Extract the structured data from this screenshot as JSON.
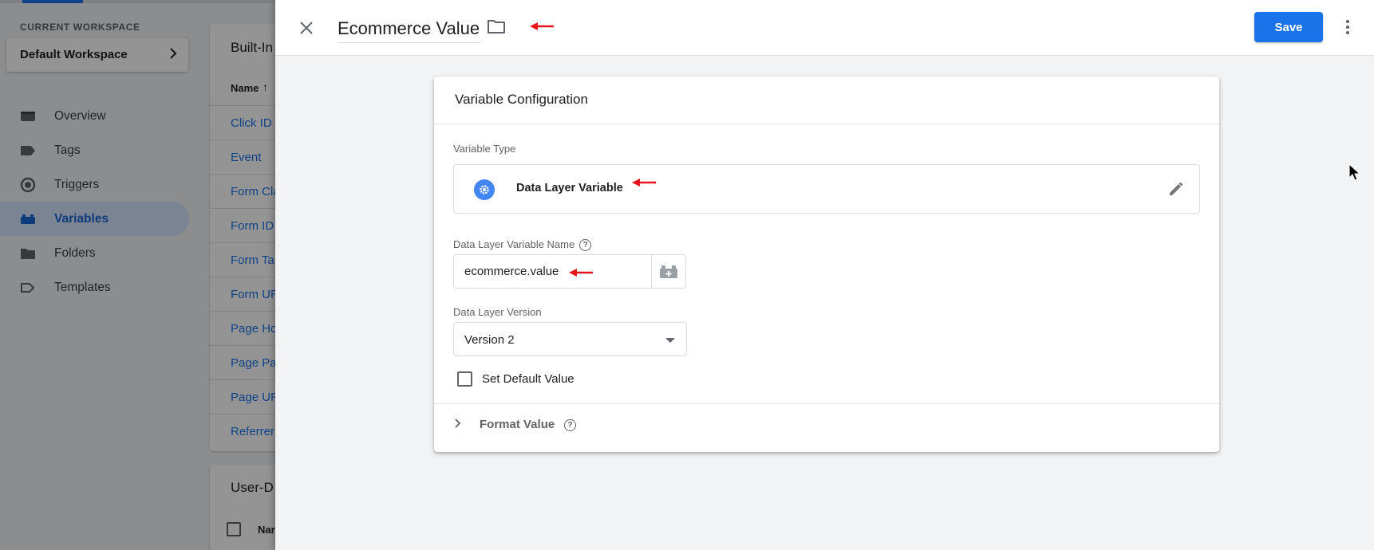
{
  "sidebar": {
    "workspace_label": "CURRENT WORKSPACE",
    "workspace_name": "Default Workspace",
    "items": [
      {
        "label": "Overview",
        "icon": "overview-icon"
      },
      {
        "label": "Tags",
        "icon": "tag-icon"
      },
      {
        "label": "Triggers",
        "icon": "trigger-icon"
      },
      {
        "label": "Variables",
        "icon": "variables-icon",
        "active": true
      },
      {
        "label": "Folders",
        "icon": "folder-icon"
      },
      {
        "label": "Templates",
        "icon": "template-icon"
      }
    ]
  },
  "builtin": {
    "title": "Built-In",
    "name_header": "Name",
    "rows": [
      "Click ID",
      "Event",
      "Form Cla",
      "Form ID",
      "Form Ta",
      "Form UR",
      "Page Ho",
      "Page Pa",
      "Page UR",
      "Referrer"
    ]
  },
  "user_defined": {
    "title": "User-D",
    "name_header": "Nar"
  },
  "panel": {
    "title": "Ecommerce Value",
    "save_label": "Save"
  },
  "config": {
    "title": "Variable Configuration",
    "type_label": "Variable Type",
    "type_name": "Data Layer Variable",
    "name_label": "Data Layer Variable Name",
    "name_value": "ecommerce.value",
    "version_label": "Data Layer Version",
    "version_value": "Version 2",
    "default_label": "Set Default Value",
    "format_label": "Format Value",
    "help_glyph": "?"
  },
  "colors": {
    "accent": "#1a73e8",
    "annotation_arrow": "#e8141c",
    "active_nav_bg": "#d2e3fc"
  }
}
